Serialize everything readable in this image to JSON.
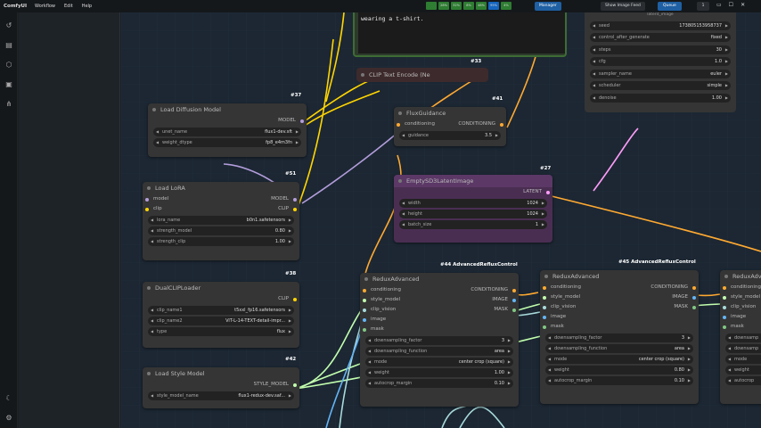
{
  "menubar": {
    "app_title": "ComfyUI",
    "menu": [
      "Workflow",
      "Edit",
      "Help"
    ],
    "stats": [
      {
        "label": "",
        "color": "#2e7d32"
      },
      {
        "label": "28%",
        "color": "#2e7d32"
      },
      {
        "label": "32%",
        "color": "#2e7d32"
      },
      {
        "label": "8%",
        "color": "#2e7d32"
      },
      {
        "label": "48%",
        "color": "#2e7d32"
      },
      {
        "label": "95%",
        "color": "#1565c0"
      },
      {
        "label": "4%",
        "color": "#2e7d32"
      }
    ],
    "manager": "Manager",
    "image_feed": "Show Image Feed",
    "queue": "Queue",
    "queue_count": "1"
  },
  "prompt_node": {
    "text": "wearing a t-shirt.",
    "id": "#33"
  },
  "clip_text_encode": {
    "title": "CLIP Text Encode (Ne"
  },
  "ksampler": {
    "top_label": "latent_image",
    "widgets": [
      {
        "name": "seed",
        "value": "173805153958737"
      },
      {
        "name": "control_after_generate",
        "value": "fixed"
      },
      {
        "name": "steps",
        "value": "30"
      },
      {
        "name": "cfg",
        "value": "1.0"
      },
      {
        "name": "sampler_name",
        "value": "euler"
      },
      {
        "name": "scheduler",
        "value": "simple"
      },
      {
        "name": "denoise",
        "value": "1.00"
      }
    ]
  },
  "load_diffusion": {
    "id": "#37",
    "title": "Load Diffusion Model",
    "output": "MODEL",
    "widgets": [
      {
        "name": "unet_name",
        "value": "flux1-dev.sft"
      },
      {
        "name": "weight_dtype",
        "value": "fp8_e4m3fn"
      }
    ]
  },
  "flux_guidance": {
    "id": "#41",
    "title": "FluxGuidance",
    "input": "conditioning",
    "output": "CONDITIONING",
    "widgets": [
      {
        "name": "guidance",
        "value": "3.5"
      }
    ]
  },
  "empty_latent": {
    "id": "#27",
    "title": "EmptySD3LatentImage",
    "output": "LATENT",
    "widgets": [
      {
        "name": "width",
        "value": "1024"
      },
      {
        "name": "height",
        "value": "1024"
      },
      {
        "name": "batch_size",
        "value": "1"
      }
    ]
  },
  "load_lora": {
    "id": "#51",
    "title": "Load LoRA",
    "inputs": [
      "model",
      "clip"
    ],
    "outputs": [
      "MODEL",
      "CLIP"
    ],
    "widgets": [
      {
        "name": "lora_name",
        "value": "b0n1.safetensors"
      },
      {
        "name": "strength_model",
        "value": "0.80"
      },
      {
        "name": "strength_clip",
        "value": "1.00"
      }
    ]
  },
  "dual_clip": {
    "id": "#38",
    "title": "DualCLIPLoader",
    "output": "CLIP",
    "widgets": [
      {
        "name": "clip_name1",
        "value": "t5xxl_fp16.safetensors"
      },
      {
        "name": "clip_name2",
        "value": "ViT-L-14-TEXT-detail-impr..."
      },
      {
        "name": "type",
        "value": "flux"
      }
    ]
  },
  "load_style": {
    "id": "#42",
    "title": "Load Style Model",
    "output": "STYLE_MODEL",
    "widgets": [
      {
        "name": "style_model_name",
        "value": "flux1-redux-dev.saf..."
      }
    ]
  },
  "redux1": {
    "id": "#44 AdvancedRefluxControl",
    "title": "ReduxAdvanced",
    "inputs": [
      "conditioning",
      "style_model",
      "clip_vision",
      "image",
      "mask"
    ],
    "outputs": [
      "CONDITIONING",
      "IMAGE",
      "MASK"
    ],
    "widgets": [
      {
        "name": "downsampling_factor",
        "value": "3"
      },
      {
        "name": "downsampling_function",
        "value": "area"
      },
      {
        "name": "mode",
        "value": "center crop (square)"
      },
      {
        "name": "weight",
        "value": "1.00"
      },
      {
        "name": "autocrop_margin",
        "value": "0.10"
      }
    ]
  },
  "redux2": {
    "id": "#45 AdvancedRefluxControl",
    "title": "ReduxAdvanced",
    "inputs": [
      "conditioning",
      "style_model",
      "clip_vision",
      "image",
      "mask"
    ],
    "outputs": [
      "CONDITIONING",
      "IMAGE",
      "MASK"
    ],
    "widgets": [
      {
        "name": "downsampling_factor",
        "value": "3"
      },
      {
        "name": "downsampling_function",
        "value": "area"
      },
      {
        "name": "mode",
        "value": "center crop (square)"
      },
      {
        "name": "weight",
        "value": "0.80"
      },
      {
        "name": "autocrop_margin",
        "value": "0.10"
      }
    ]
  },
  "redux3": {
    "title": "ReduxAdv",
    "inputs": [
      "conditioning",
      "style_model",
      "clip_vision",
      "image",
      "mask"
    ],
    "widgets": [
      "downsamp",
      "downsamp",
      "mode",
      "weight",
      "autocrop"
    ]
  },
  "colors": {
    "model": "#b39ddb",
    "clip": "#ffd500",
    "conditioning": "#ffa931",
    "latent": "#ff9cf9",
    "style": "#c2ffae",
    "clip_vision": "#a8dadc",
    "image": "#64b5f6",
    "mask": "#81c784"
  },
  "sidebar_icons": [
    "history-icon",
    "queue-icon",
    "box-icon",
    "image-icon",
    "nodes-icon",
    "theme-icon",
    "settings-icon"
  ]
}
